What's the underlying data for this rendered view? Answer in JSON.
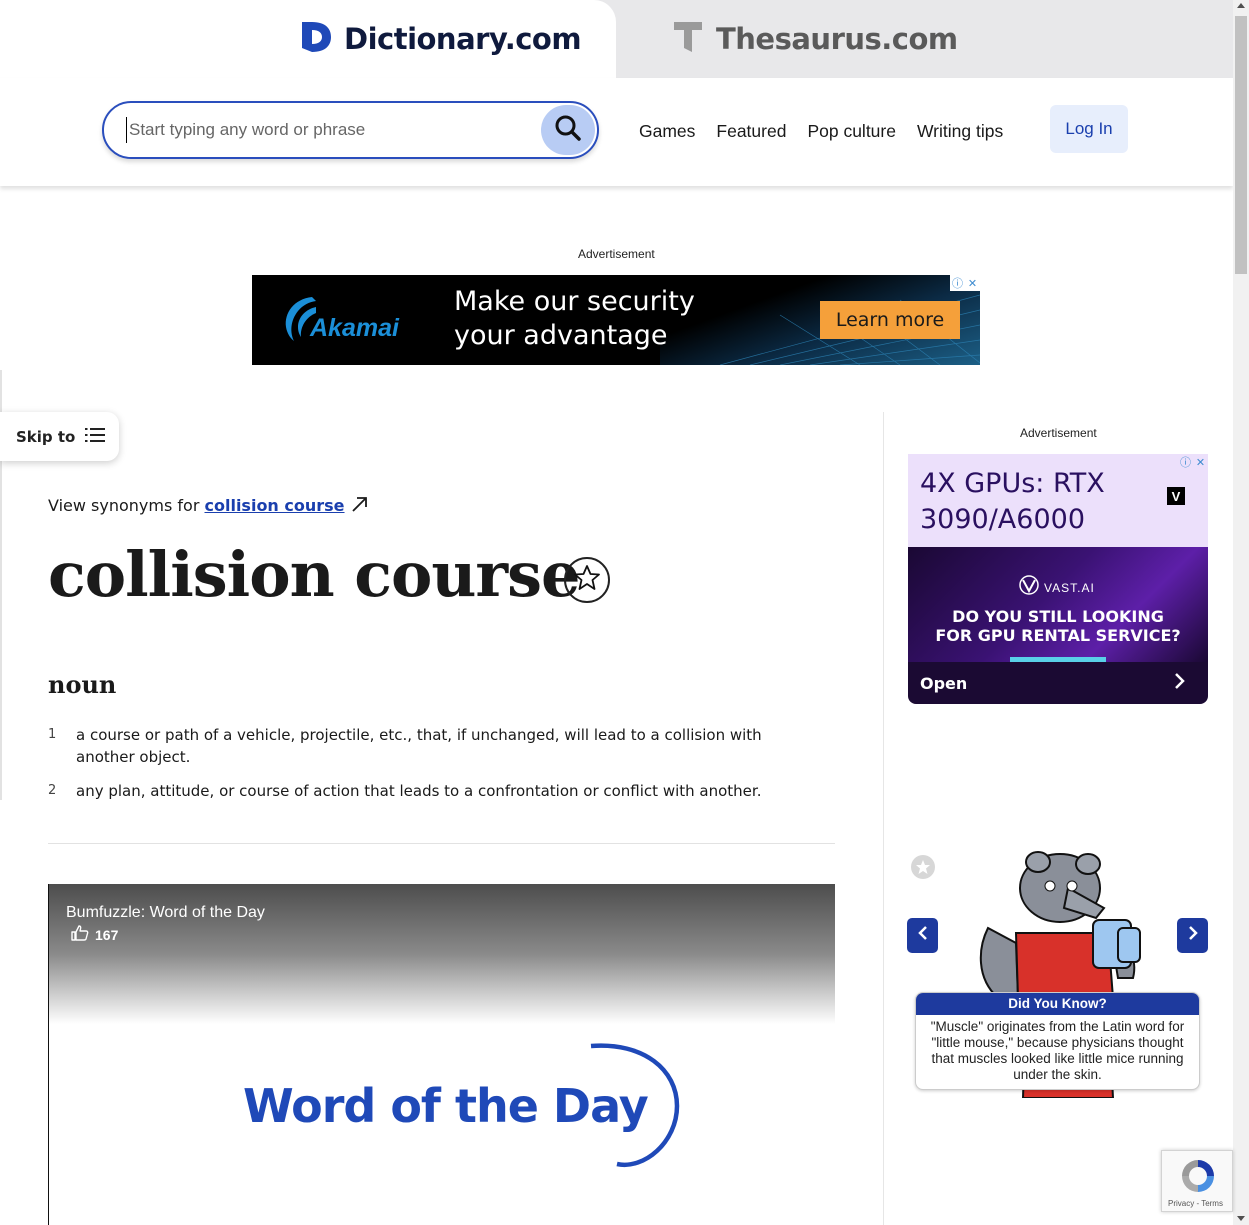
{
  "tabs": {
    "dictionary": "Dictionary.com",
    "thesaurus": "Thesaurus.com"
  },
  "search": {
    "placeholder": "Start typing any word or phrase",
    "value": ""
  },
  "nav": {
    "items": [
      "Games",
      "Featured",
      "Pop culture",
      "Writing tips"
    ],
    "login": "Log In"
  },
  "top_ad": {
    "label": "Advertisement",
    "brand": "Akamai",
    "headline_line1": "Make our security",
    "headline_line2": "your advantage",
    "cta": "Learn more"
  },
  "skip_to": "Skip to",
  "entry": {
    "synonyms_prefix": "View synonyms for",
    "synonyms_link": "collision course",
    "headword": "collision course",
    "part_of_speech": "noun",
    "definitions": [
      {
        "num": "1",
        "text": "a course or path of a vehicle, projectile, etc., that, if unchanged, will lead to a collision with another object."
      },
      {
        "num": "2",
        "text": "any plan, attitude, or course of action that leads to a confrontation or conflict with another."
      }
    ]
  },
  "video": {
    "title": "Bumfuzzle: Word of the Day",
    "likes": "167",
    "slide_text": "Word of the Day"
  },
  "right_ad": {
    "label": "Advertisement",
    "headline_line1": "4X GPUs: RTX",
    "headline_line2": "3090/A6000",
    "logo_letter": "V",
    "brand": "VAST.AI",
    "question_line1": "DO YOU STILL LOOKING",
    "question_line2": "FOR GPU RENTAL SERVICE?",
    "cta": "Open"
  },
  "did_you_know": {
    "title": "Did You Know?",
    "text": "\"Muscle\" originates from the Latin word for \"little mouse,\" because physicians thought that muscles looked like little mice running under the skin."
  },
  "recaptcha": {
    "links": "Privacy - Terms"
  },
  "colors": {
    "brand_blue": "#1f49b8",
    "link_blue": "#1a3fae",
    "search_border": "#2a4ebd",
    "search_button": "#b8ccf4",
    "ad_orange": "#f5a03a",
    "dyk_blue": "#1e3a9e"
  }
}
